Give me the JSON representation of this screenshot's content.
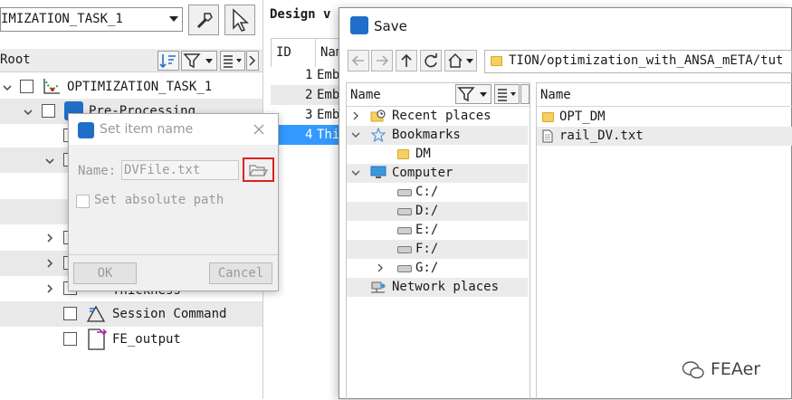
{
  "left_panel": {
    "task_combo": "IMIZATION_TASK_1",
    "root_label": "Root",
    "tree": [
      {
        "label": "OPTIMIZATION_TASK_1",
        "expanded": true
      },
      {
        "label": "Pre-Processing",
        "expanded": true
      },
      {
        "label": "Thickness",
        "expanded": false
      },
      {
        "label": "Session Command"
      },
      {
        "label": "FE_output"
      }
    ]
  },
  "design_panel": {
    "title": "Design v",
    "columns": [
      "ID",
      "Nam"
    ],
    "rows": [
      {
        "id": "1",
        "name": "Emb"
      },
      {
        "id": "2",
        "name": "Emb"
      },
      {
        "id": "3",
        "name": "Emb"
      },
      {
        "id": "4",
        "name": "Thi"
      }
    ],
    "selected_row": 3
  },
  "set_item_dialog": {
    "title": "Set item name",
    "name_label": "Name:",
    "name_value": "DVFile.txt",
    "checkbox_label": "Set absolute path",
    "ok_label": "OK",
    "cancel_label": "Cancel"
  },
  "save_dialog": {
    "title": "Save",
    "path": "TION/optimization_with_ANSA_mETA/tut",
    "left_header": "Name",
    "places": [
      {
        "label": "Recent places",
        "icon": "recent-places-icon"
      },
      {
        "label": "Bookmarks",
        "icon": "star-icon"
      },
      {
        "label": "DM",
        "icon": "folder-icon"
      },
      {
        "label": "Computer",
        "icon": "computer-icon"
      },
      {
        "label": "C:/",
        "icon": "drive-icon"
      },
      {
        "label": "D:/",
        "icon": "drive-icon"
      },
      {
        "label": "E:/",
        "icon": "drive-icon"
      },
      {
        "label": "F:/",
        "icon": "drive-icon"
      },
      {
        "label": "G:/",
        "icon": "drive-icon"
      },
      {
        "label": "Network places",
        "icon": "network-icon"
      }
    ],
    "right_header": "Name",
    "files": [
      {
        "label": "OPT_DM",
        "icon": "folder-icon"
      },
      {
        "label": "rail_DV.txt",
        "icon": "text-file-icon"
      }
    ]
  },
  "watermark": {
    "text": "FEAer"
  },
  "colors": {
    "accent_blue": "#1f6fc9",
    "selection_blue": "#3399ff",
    "highlight_red": "#e0201e",
    "folder_yellow": "#f5cf5f"
  }
}
